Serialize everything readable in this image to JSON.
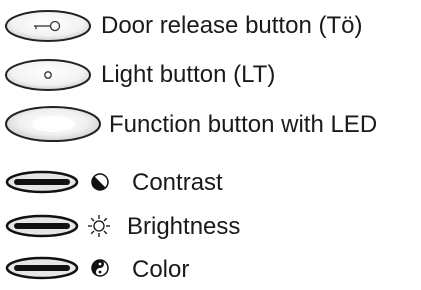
{
  "legend": {
    "items": [
      {
        "label": "Door release button (Tö)",
        "icon": "key-icon"
      },
      {
        "label": "Light button (LT)",
        "icon": "dot-icon"
      },
      {
        "label": "Function button with LED",
        "icon": "led-icon"
      },
      {
        "label": "Contrast",
        "icon": "contrast-icon"
      },
      {
        "label": "Brightness",
        "icon": "sun-icon"
      },
      {
        "label": "Color",
        "icon": "color-wheel-icon"
      }
    ]
  }
}
